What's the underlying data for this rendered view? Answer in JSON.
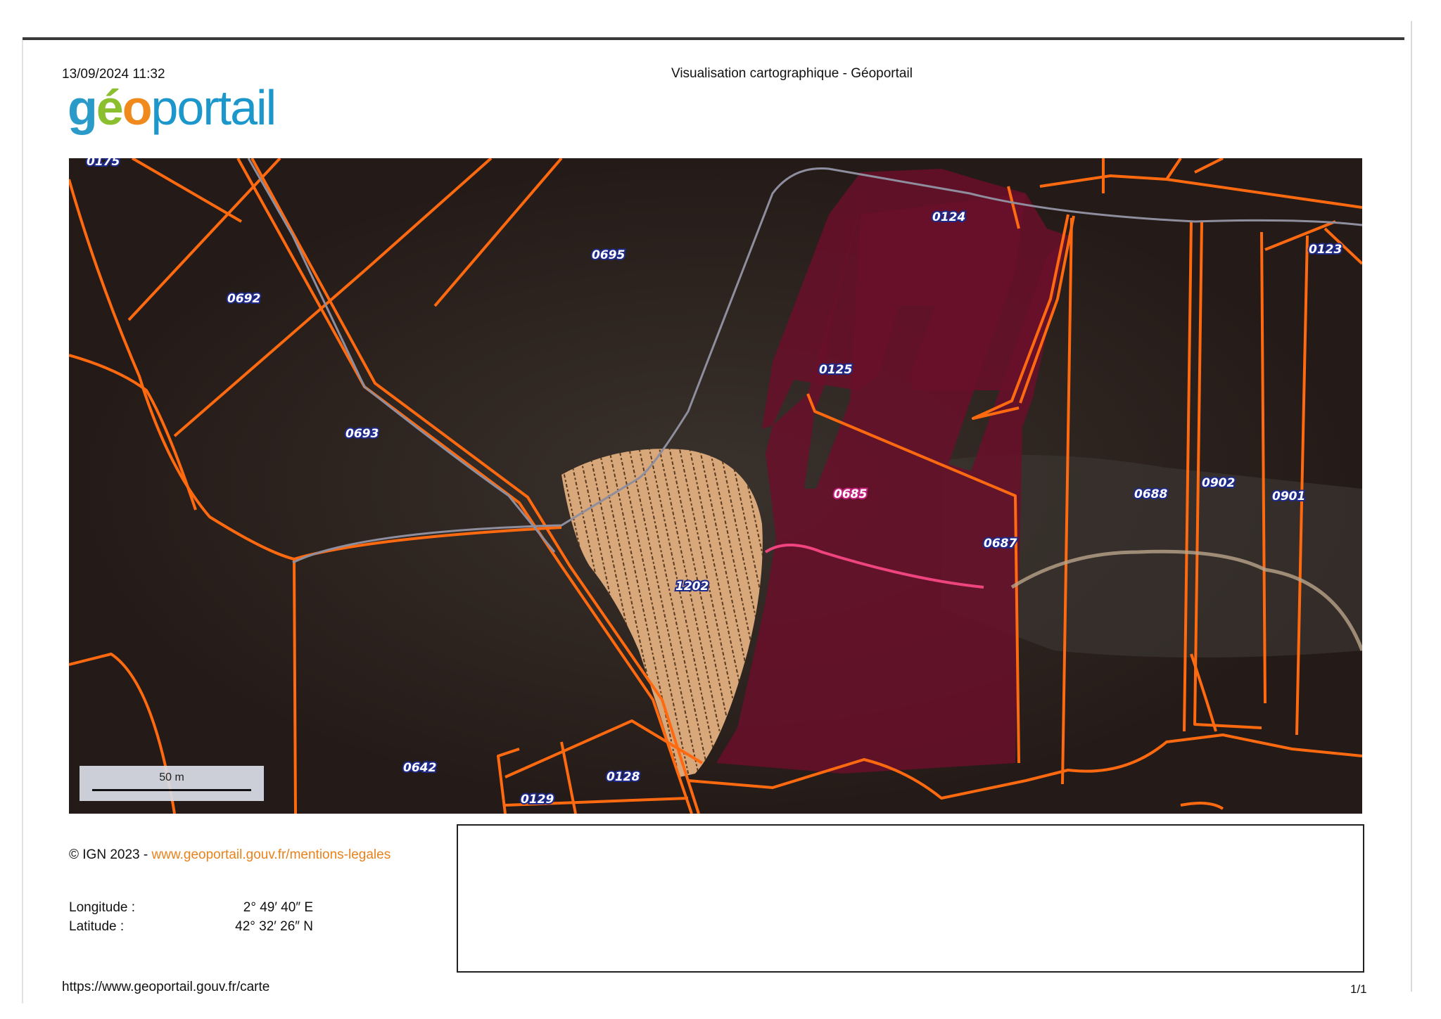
{
  "header": {
    "datetime": "13/09/2024 11:32",
    "title": "Visualisation cartographique - Géoportail"
  },
  "logo": {
    "part1": "g",
    "part2": "é",
    "part3": "o",
    "part4": "portail"
  },
  "map": {
    "scale_label": "50 m",
    "parcels": [
      "0175",
      "0692",
      "0695",
      "0124",
      "0123",
      "0125",
      "0693",
      "0685",
      "0688",
      "0902",
      "0901",
      "0687",
      "1202",
      "0642",
      "0128",
      "0129"
    ],
    "colors": {
      "boundary": "#ff6a10",
      "road": "#8e8e9e",
      "highlight": "#c0145a",
      "cleared": "#d8a77a"
    }
  },
  "credit": {
    "text": "© IGN 2023 - ",
    "link": "www.geoportail.gouv.fr/mentions-legales"
  },
  "coordinates": {
    "longitude_label": "Longitude :",
    "longitude_value": "2° 49′ 40″ E",
    "latitude_label": "Latitude :",
    "latitude_value": "42° 32′ 26″ N"
  },
  "footer": {
    "url": "https://www.geoportail.gouv.fr/carte",
    "page": "1/1"
  }
}
